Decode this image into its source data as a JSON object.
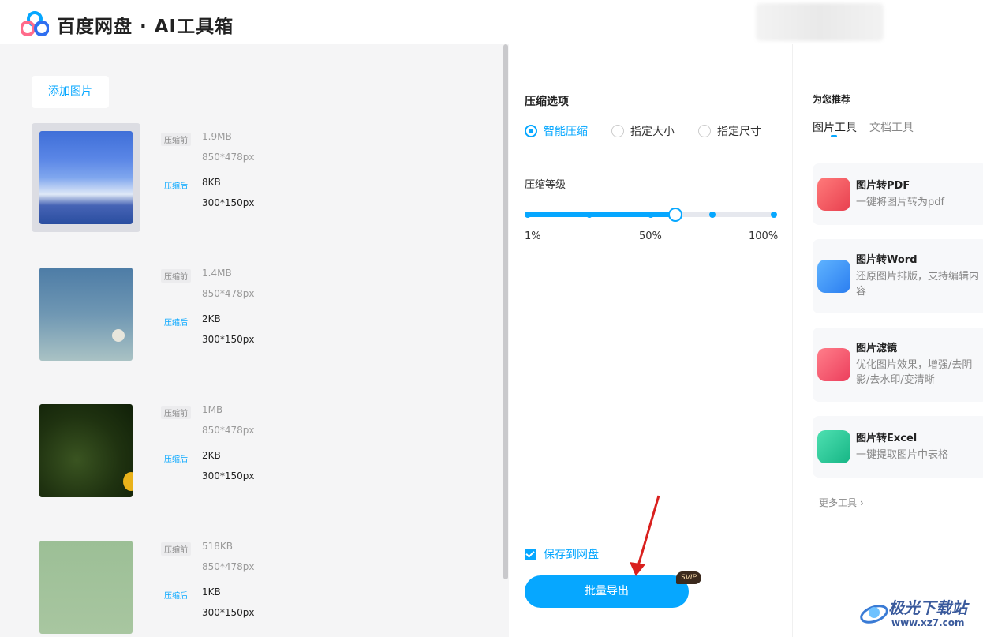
{
  "header": {
    "title": "百度网盘 · AI工具箱"
  },
  "left": {
    "add_button": "添加图片",
    "items": [
      {
        "before_tag": "压缩前",
        "before_size": "1.9MB",
        "before_dim": "850*478px",
        "after_tag": "压缩后",
        "after_size": "8KB",
        "after_dim": "300*150px"
      },
      {
        "before_tag": "压缩前",
        "before_size": "1.4MB",
        "before_dim": "850*478px",
        "after_tag": "压缩后",
        "after_size": "2KB",
        "after_dim": "300*150px"
      },
      {
        "before_tag": "压缩前",
        "before_size": "1MB",
        "before_dim": "850*478px",
        "after_tag": "压缩后",
        "after_size": "2KB",
        "after_dim": "300*150px"
      },
      {
        "before_tag": "压缩前",
        "before_size": "518KB",
        "before_dim": "850*478px",
        "after_tag": "压缩后",
        "after_size": "1KB",
        "after_dim": "300*150px"
      }
    ]
  },
  "options": {
    "title": "压缩选项",
    "modes": [
      "智能压缩",
      "指定大小",
      "指定尺寸"
    ],
    "selected_mode": "智能压缩",
    "level_title": "压缩等级",
    "level_labels": [
      "1%",
      "50%",
      "100%"
    ],
    "level_value_percent": 60,
    "save_label": "保存到网盘",
    "save_checked": true,
    "export_button": "批量导出",
    "svip_badge": "SVIP"
  },
  "recommend": {
    "title": "为您推荐",
    "tabs": [
      "图片工具",
      "文档工具"
    ],
    "active_tab": "图片工具",
    "tools": [
      {
        "name": "图片转PDF",
        "desc": "一键将图片转为pdf",
        "color": "#f05a62"
      },
      {
        "name": "图片转Word",
        "desc": "还原图片排版，支持编辑内容",
        "color": "#2f8ef5"
      },
      {
        "name": "图片滤镜",
        "desc": "优化图片效果，增强/去阴影/去水印/变清晰",
        "color": "#f4506a"
      },
      {
        "name": "图片转Excel",
        "desc": "一键提取图片中表格",
        "color": "#1fbf8e"
      }
    ],
    "more": "更多工具 ›"
  },
  "watermark": {
    "name": "极光下载站",
    "url": "www.xz7.com"
  },
  "colors": {
    "accent": "#06a7ff"
  }
}
